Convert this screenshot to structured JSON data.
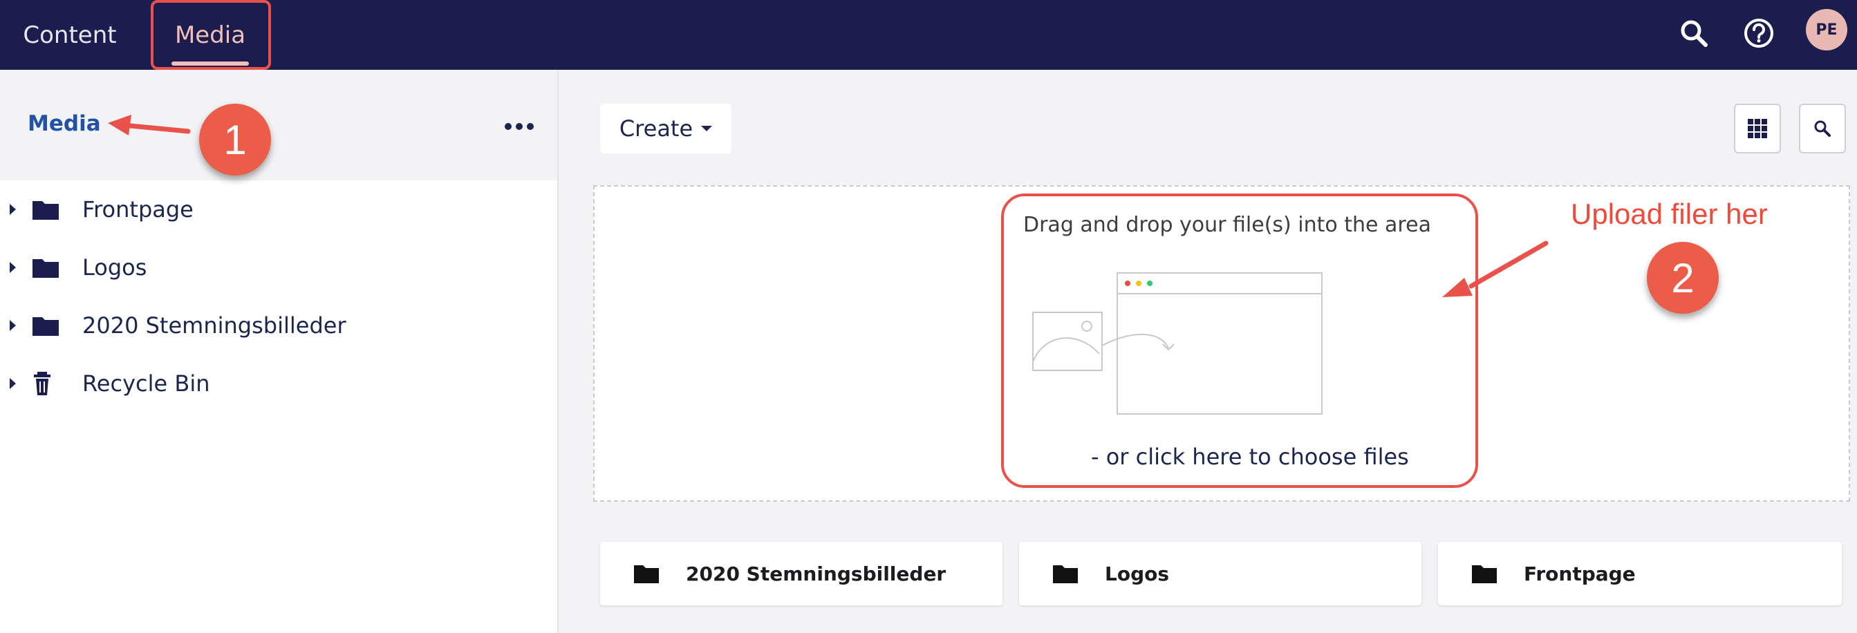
{
  "topbar": {
    "tabs": [
      {
        "label": "Content"
      },
      {
        "label": "Media"
      }
    ],
    "search_icon": "search-icon",
    "help_icon": "help-icon",
    "avatar_initials": "PE",
    "colors": {
      "background": "#1b1d4f",
      "active_tab": "#f2c0b6",
      "avatar": "#e9b8b3"
    }
  },
  "sidebar": {
    "title": "Media",
    "more_icon": "more-options-icon",
    "items": [
      {
        "label": "Frontpage",
        "icon": "folder-icon"
      },
      {
        "label": "Logos",
        "icon": "folder-icon"
      },
      {
        "label": "2020 Stemningsbilleder",
        "icon": "folder-icon"
      },
      {
        "label": "Recycle Bin",
        "icon": "trash-icon"
      }
    ]
  },
  "toolbar": {
    "create_label": "Create",
    "grid_icon": "grid-view-icon",
    "search_icon": "search-icon"
  },
  "dropzone": {
    "text": "Drag and drop your file(s) into the area",
    "link": "- or click here to choose files"
  },
  "cards": [
    {
      "label": "2020 Stemningsbilleder",
      "icon": "folder-icon"
    },
    {
      "label": "Logos",
      "icon": "folder-icon"
    },
    {
      "label": "Frontpage",
      "icon": "folder-icon"
    }
  ],
  "annotations": {
    "badge_1": "1",
    "badge_2": "2",
    "note": "Upload filer her",
    "color": "#eb5d48"
  }
}
